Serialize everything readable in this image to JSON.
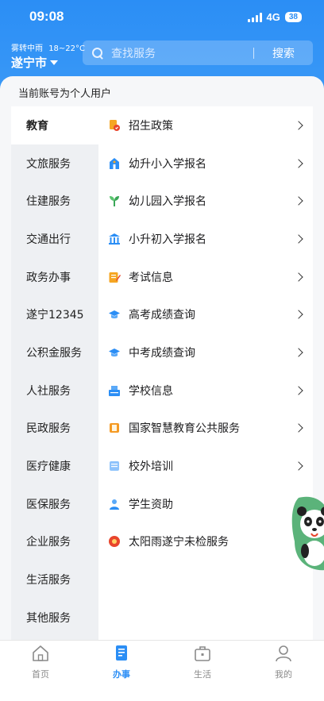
{
  "status_bar": {
    "time": "09:08",
    "network": "4G",
    "battery": "38"
  },
  "weather": {
    "condition": "雾转中雨",
    "temp": "18~22°C",
    "city": "遂宁市"
  },
  "search": {
    "placeholder": "查找服务",
    "button": "搜索"
  },
  "account_note": "当前账号为个人用户",
  "sidebar": {
    "items": [
      {
        "label": "教育"
      },
      {
        "label": "文旅服务"
      },
      {
        "label": "住建服务"
      },
      {
        "label": "交通出行"
      },
      {
        "label": "政务办事"
      },
      {
        "label": "遂宁12345"
      },
      {
        "label": "公积金服务"
      },
      {
        "label": "人社服务"
      },
      {
        "label": "民政服务"
      },
      {
        "label": "医疗健康"
      },
      {
        "label": "医保服务"
      },
      {
        "label": "企业服务"
      },
      {
        "label": "生活服务"
      },
      {
        "label": "其他服务"
      }
    ],
    "active": "教育"
  },
  "services": {
    "items": [
      {
        "label": "招生政策",
        "icon": "admission-policy-icon"
      },
      {
        "label": "幼升小入学报名",
        "icon": "school-building-icon"
      },
      {
        "label": "幼儿园入学报名",
        "icon": "sprout-icon"
      },
      {
        "label": "小升初入学报名",
        "icon": "institution-icon"
      },
      {
        "label": "考试信息",
        "icon": "exam-note-icon"
      },
      {
        "label": "高考成绩查询",
        "icon": "graduation-cap-icon"
      },
      {
        "label": "中考成绩查询",
        "icon": "graduation-cap-icon"
      },
      {
        "label": "学校信息",
        "icon": "school-info-icon"
      },
      {
        "label": "国家智慧教育公共服务",
        "icon": "smart-education-icon"
      },
      {
        "label": "校外培训",
        "icon": "training-icon"
      },
      {
        "label": "学生资助",
        "icon": "student-aid-icon"
      },
      {
        "label": "太阳雨遂宁未检服务",
        "icon": "sun-service-icon"
      }
    ]
  },
  "tabbar": {
    "items": [
      {
        "label": "首页",
        "icon": "home-icon"
      },
      {
        "label": "办事",
        "icon": "service-doc-icon"
      },
      {
        "label": "生活",
        "icon": "briefcase-icon"
      },
      {
        "label": "我的",
        "icon": "user-icon"
      }
    ],
    "active": "办事"
  },
  "colors": {
    "brand": "#2b8ef5",
    "inactive_tab": "#8a8a8a"
  }
}
